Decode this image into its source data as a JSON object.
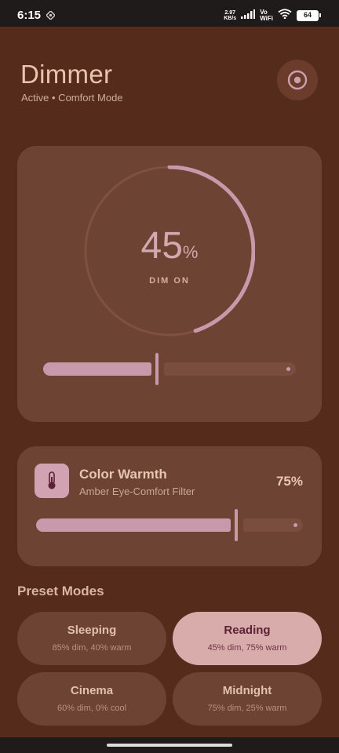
{
  "status_bar": {
    "time": "6:15",
    "speed_top": "2.97",
    "speed_bottom": "KB/s",
    "vowifi_top": "Vo",
    "vowifi_bottom": "WiFi",
    "battery": "64",
    "icons": [
      "location-icon",
      "signal-icon",
      "wifi-icon",
      "battery-icon"
    ]
  },
  "header": {
    "title": "Dimmer",
    "status": "Active • Comfort Mode",
    "power_icon": "power-ring-icon"
  },
  "dim": {
    "value": "45",
    "unit": "%",
    "label": "DIM ON",
    "level": 0.45
  },
  "warmth": {
    "icon": "thermometer-icon",
    "title": "Color Warmth",
    "subtitle": "Amber Eye-Comfort Filter",
    "value": "75%",
    "level": 0.75
  },
  "presets": {
    "title": "Preset Modes",
    "items": [
      {
        "name": "Sleeping",
        "desc": "85% dim, 40% warm",
        "active": false
      },
      {
        "name": "Reading",
        "desc": "45% dim, 75% warm",
        "active": true
      },
      {
        "name": "Cinema",
        "desc": "60% dim, 0% cool",
        "active": false
      },
      {
        "name": "Midnight",
        "desc": "75% dim, 25% warm",
        "active": false
      }
    ]
  },
  "colors": {
    "background": "#552c1b",
    "card": "#6d4333",
    "accent": "#c899aa",
    "active_preset": "#d7acaa"
  }
}
